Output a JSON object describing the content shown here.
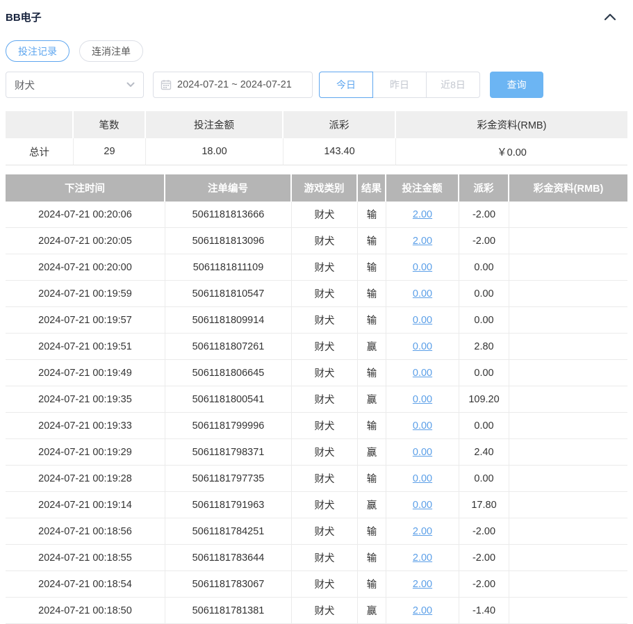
{
  "header": {
    "title": "BB电子"
  },
  "tabs": [
    {
      "label": "投注记录",
      "active": true
    },
    {
      "label": "连消注单",
      "active": false
    }
  ],
  "filters": {
    "game_select_value": "财犬",
    "date_range": "2024-07-21 ~ 2024-07-21",
    "quick_buttons": [
      {
        "label": "今日",
        "active": true
      },
      {
        "label": "昨日",
        "active": false
      },
      {
        "label": "近8日",
        "active": false
      }
    ],
    "query_label": "查询"
  },
  "summary": {
    "headers": [
      "",
      "笔数",
      "投注金额",
      "派彩",
      "彩金资料(RMB)"
    ],
    "total": {
      "label": "总计",
      "count": "29",
      "bet_amount": "18.00",
      "payout": "143.40",
      "bonus": "￥0.00"
    }
  },
  "table": {
    "headers": [
      "下注时间",
      "注单编号",
      "游戏类别",
      "结果",
      "投注金额",
      "派彩",
      "彩金资料(RMB)"
    ],
    "rows": [
      {
        "time": "2024-07-21 00:20:06",
        "order_id": "5061181813666",
        "game": "财犬",
        "result": "输",
        "bet": "2.00",
        "payout": "-2.00",
        "bonus": ""
      },
      {
        "time": "2024-07-21 00:20:05",
        "order_id": "5061181813096",
        "game": "财犬",
        "result": "输",
        "bet": "2.00",
        "payout": "-2.00",
        "bonus": ""
      },
      {
        "time": "2024-07-21 00:20:00",
        "order_id": "5061181811109",
        "game": "财犬",
        "result": "输",
        "bet": "0.00",
        "payout": "0.00",
        "bonus": ""
      },
      {
        "time": "2024-07-21 00:19:59",
        "order_id": "5061181810547",
        "game": "财犬",
        "result": "输",
        "bet": "0.00",
        "payout": "0.00",
        "bonus": ""
      },
      {
        "time": "2024-07-21 00:19:57",
        "order_id": "5061181809914",
        "game": "财犬",
        "result": "输",
        "bet": "0.00",
        "payout": "0.00",
        "bonus": ""
      },
      {
        "time": "2024-07-21 00:19:51",
        "order_id": "5061181807261",
        "game": "财犬",
        "result": "赢",
        "bet": "0.00",
        "payout": "2.80",
        "bonus": ""
      },
      {
        "time": "2024-07-21 00:19:49",
        "order_id": "5061181806645",
        "game": "财犬",
        "result": "输",
        "bet": "0.00",
        "payout": "0.00",
        "bonus": ""
      },
      {
        "time": "2024-07-21 00:19:35",
        "order_id": "5061181800541",
        "game": "财犬",
        "result": "赢",
        "bet": "0.00",
        "payout": "109.20",
        "bonus": ""
      },
      {
        "time": "2024-07-21 00:19:33",
        "order_id": "5061181799996",
        "game": "财犬",
        "result": "输",
        "bet": "0.00",
        "payout": "0.00",
        "bonus": ""
      },
      {
        "time": "2024-07-21 00:19:29",
        "order_id": "5061181798371",
        "game": "财犬",
        "result": "赢",
        "bet": "0.00",
        "payout": "2.40",
        "bonus": ""
      },
      {
        "time": "2024-07-21 00:19:28",
        "order_id": "5061181797735",
        "game": "财犬",
        "result": "输",
        "bet": "0.00",
        "payout": "0.00",
        "bonus": ""
      },
      {
        "time": "2024-07-21 00:19:14",
        "order_id": "5061181791963",
        "game": "财犬",
        "result": "赢",
        "bet": "0.00",
        "payout": "17.80",
        "bonus": ""
      },
      {
        "time": "2024-07-21 00:18:56",
        "order_id": "5061181784251",
        "game": "财犬",
        "result": "输",
        "bet": "2.00",
        "payout": "-2.00",
        "bonus": ""
      },
      {
        "time": "2024-07-21 00:18:55",
        "order_id": "5061181783644",
        "game": "财犬",
        "result": "输",
        "bet": "2.00",
        "payout": "-2.00",
        "bonus": ""
      },
      {
        "time": "2024-07-21 00:18:54",
        "order_id": "5061181783067",
        "game": "财犬",
        "result": "输",
        "bet": "2.00",
        "payout": "-2.00",
        "bonus": ""
      },
      {
        "time": "2024-07-21 00:18:50",
        "order_id": "5061181781381",
        "game": "财犬",
        "result": "赢",
        "bet": "2.00",
        "payout": "-1.40",
        "bonus": ""
      }
    ]
  },
  "icons": {
    "collapse": "chevron-up-icon",
    "calendar": "calendar-icon",
    "select_caret": "chevron-down-icon"
  },
  "colors": {
    "accent": "#5ea6ef",
    "query_button": "#6cb5f3",
    "link": "#5b9fe8",
    "negative": "#e25b66",
    "table_header_bg": "#b5b5b5",
    "summary_header_bg": "#efefef"
  }
}
